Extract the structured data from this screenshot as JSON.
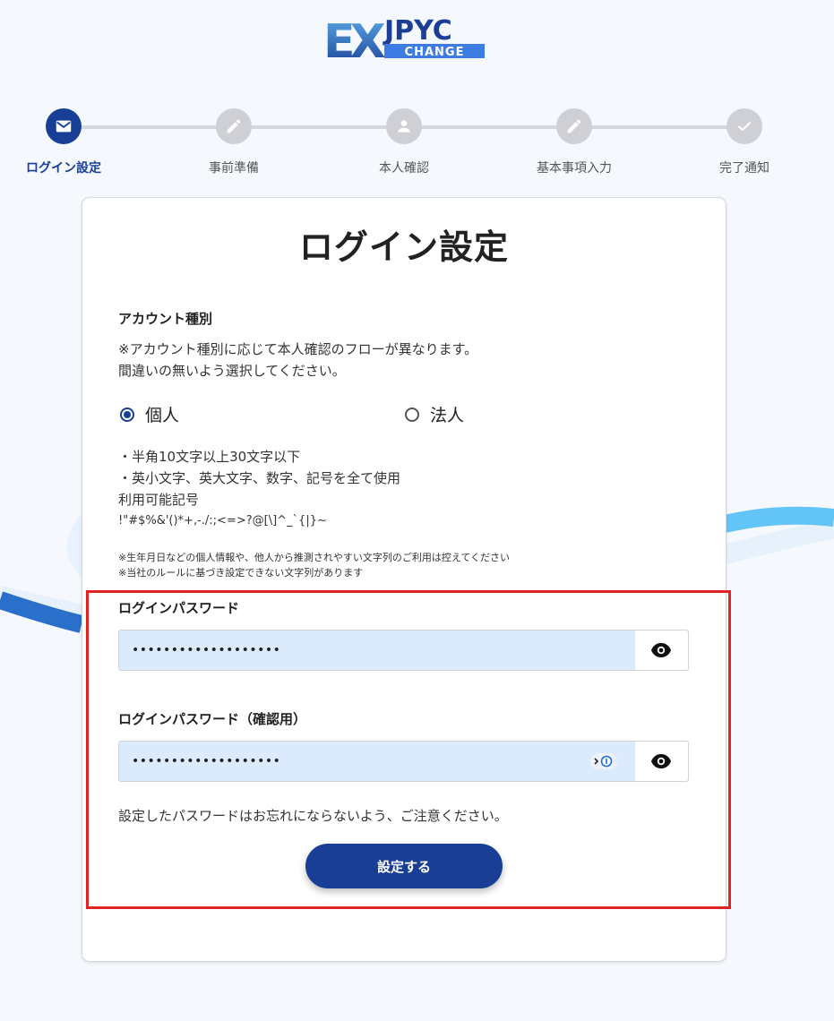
{
  "logo": {
    "main": "EX",
    "brand": "JPYC",
    "sub": "CHANGE"
  },
  "steps": [
    {
      "label": "ログイン設定",
      "icon": "mail-icon",
      "active": true
    },
    {
      "label": "事前準備",
      "icon": "pencil-icon",
      "active": false
    },
    {
      "label": "本人確認",
      "icon": "person-icon",
      "active": false
    },
    {
      "label": "基本事項入力",
      "icon": "pencil-icon",
      "active": false
    },
    {
      "label": "完了通知",
      "icon": "check-icon",
      "active": false
    }
  ],
  "form": {
    "title": "ログイン設定",
    "account_type": {
      "label": "アカウント種別",
      "note_line1": "※アカウント種別に応じて本人確認のフローが異なります。",
      "note_line2": "間違いの無いよう選択してください。",
      "options": [
        {
          "label": "個人",
          "selected": true
        },
        {
          "label": "法人",
          "selected": false
        }
      ]
    },
    "rules": {
      "line1": "・半角10文字以上30文字以下",
      "line2": "・英小文字、英大文字、数字、記号を全て使用",
      "symbols_label": "利用可能記号",
      "symbols": "!\"#$%&'()*+,-./:;<=>?@[\\]^_`{|}~",
      "caution1": "※生年月日などの個人情報や、他人から推測されやすい文字列のご利用は控えてください",
      "caution2": "※当社のルールに基づき設定できない文字列があります"
    },
    "password": {
      "label": "ログインパスワード",
      "value": "•••••••••••••••••••"
    },
    "password_confirm": {
      "label": "ログインパスワード（確認用）",
      "value": "•••••••••••••••••••"
    },
    "reminder": "設定したパスワードはお忘れにならないよう、ご注意ください。",
    "submit_label": "設定する"
  },
  "colors": {
    "primary": "#183f95",
    "step_inactive": "#cfcfd6",
    "input_fill": "#dceafd",
    "highlight": "#e02424",
    "swoosh_dark": "#2a6fc9",
    "swoosh_light": "#62c4f7"
  }
}
